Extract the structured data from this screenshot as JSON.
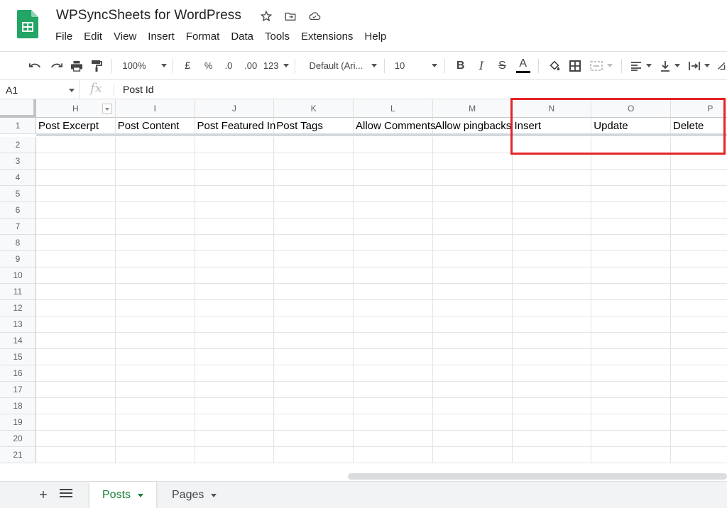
{
  "app": {
    "title": "WPSyncSheets for WordPress",
    "menu": [
      "File",
      "Edit",
      "View",
      "Insert",
      "Format",
      "Data",
      "Tools",
      "Extensions",
      "Help"
    ]
  },
  "toolbar": {
    "zoom": "100%",
    "currency": "£",
    "percent": "%",
    "decrease_decimal": ".0",
    "increase_decimal": ".00",
    "number_format": "123",
    "font": "Default (Ari...",
    "font_size": "10"
  },
  "formula": {
    "cell_ref": "A1",
    "fx": "fx",
    "content": "Post Id"
  },
  "columns": [
    "H",
    "I",
    "J",
    "K",
    "L",
    "M",
    "N",
    "O",
    "P"
  ],
  "rows": [
    "1",
    "2",
    "3",
    "4",
    "5",
    "6",
    "7",
    "8",
    "9",
    "10",
    "11",
    "12",
    "13",
    "14",
    "15",
    "16",
    "17",
    "18",
    "19",
    "20",
    "21"
  ],
  "row1_values": [
    "Post Excerpt",
    "Post Content",
    "Post Featured In",
    "Post Tags",
    "Allow Comments",
    "Allow pingbacks",
    "Insert",
    "Update",
    "Delete"
  ],
  "sheets": {
    "add": "+",
    "tabs": [
      {
        "label": "Posts",
        "active": true
      },
      {
        "label": "Pages",
        "active": false
      }
    ]
  },
  "colors": {
    "accent": "#188038",
    "highlight": "#e52428"
  }
}
